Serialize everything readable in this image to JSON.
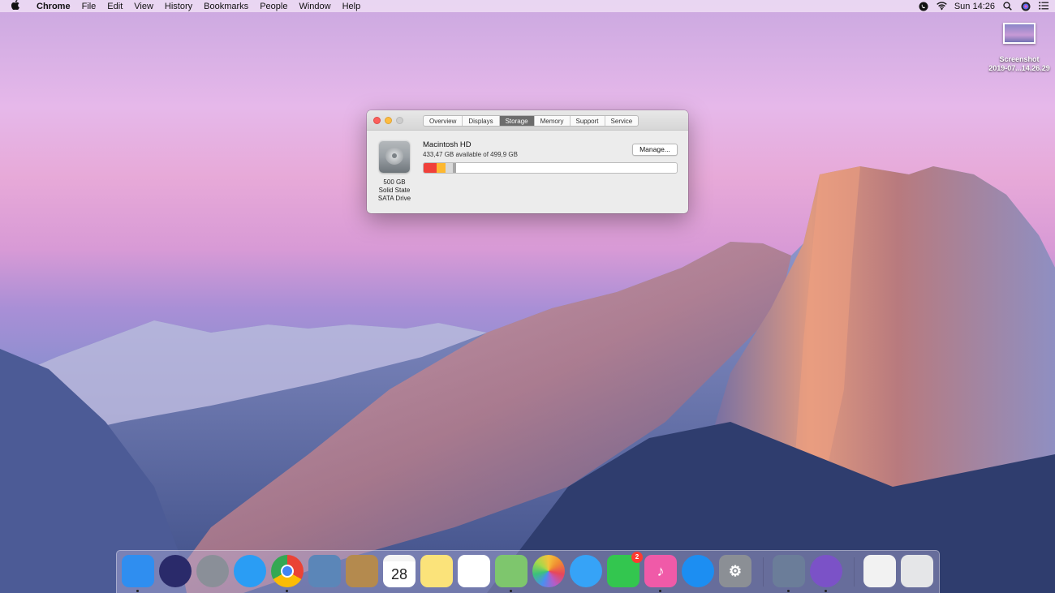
{
  "menubar": {
    "app_name": "Chrome",
    "menus": [
      "File",
      "Edit",
      "View",
      "History",
      "Bookmarks",
      "People",
      "Window",
      "Help"
    ],
    "clock": "Sun 14:26"
  },
  "desktop_file": {
    "label_line1": "Screenshot",
    "label_line2": "2019-07...14.26.29"
  },
  "window": {
    "tabs": [
      "Overview",
      "Displays",
      "Storage",
      "Memory",
      "Support",
      "Service"
    ],
    "active_tab": "Storage",
    "disk": {
      "capacity": "500 GB",
      "type_line1": "Solid State",
      "type_line2": "SATA Drive"
    },
    "volume": {
      "name": "Macintosh HD",
      "available_text": "433,47 GB available of 499,9 GB",
      "manage_label": "Manage..."
    },
    "storage_usage": {
      "segments": [
        {
          "name": "red-segment",
          "fraction": 0.052,
          "color": "#f0403a"
        },
        {
          "name": "yellow-segment",
          "fraction": 0.035,
          "color": "#fdb830"
        },
        {
          "name": "lightgray-segment",
          "fraction": 0.03,
          "color": "#d9d9d9"
        },
        {
          "name": "gray-segment",
          "fraction": 0.011,
          "color": "#a8a8a8"
        }
      ],
      "free_color": "#ffffff"
    }
  },
  "dock": {
    "apps": [
      {
        "name": "finder",
        "color": "#2f8ef0",
        "glyph": ""
      },
      {
        "name": "siri",
        "color": "#2a2a6a",
        "glyph": ""
      },
      {
        "name": "launchpad",
        "color": "#8a8f98",
        "glyph": ""
      },
      {
        "name": "safari",
        "color": "#2a9df4",
        "glyph": ""
      },
      {
        "name": "chrome",
        "color": "#ffffff",
        "glyph": ""
      },
      {
        "name": "mail-hawk",
        "color": "#5b86b8",
        "glyph": ""
      },
      {
        "name": "notefile",
        "color": "#b48a4e",
        "glyph": ""
      },
      {
        "name": "calendar",
        "color": "#ffffff",
        "glyph": "28"
      },
      {
        "name": "notes",
        "color": "#fbe37a",
        "glyph": ""
      },
      {
        "name": "reminders",
        "color": "#ffffff",
        "glyph": ""
      },
      {
        "name": "maps",
        "color": "#7ec66d",
        "glyph": ""
      },
      {
        "name": "photos",
        "color": "#ffffff",
        "glyph": ""
      },
      {
        "name": "messages",
        "color": "#36a3f7",
        "glyph": ""
      },
      {
        "name": "facetime",
        "color": "#33c64f",
        "glyph": "",
        "badge": "2"
      },
      {
        "name": "itunes",
        "color": "#f05aa8",
        "glyph": "♪"
      },
      {
        "name": "app-store",
        "color": "#1c8ef2",
        "glyph": ""
      },
      {
        "name": "system-preferences",
        "color": "#8b8f95",
        "glyph": "⚙"
      },
      {
        "name": "preview",
        "color": "#6b7d99",
        "glyph": ""
      },
      {
        "name": "viber",
        "color": "#7b52c7",
        "glyph": ""
      },
      {
        "name": "chrome-window",
        "color": "#f2f2f2",
        "glyph": ""
      },
      {
        "name": "trash",
        "color": "#e5e6e8",
        "glyph": ""
      }
    ]
  }
}
